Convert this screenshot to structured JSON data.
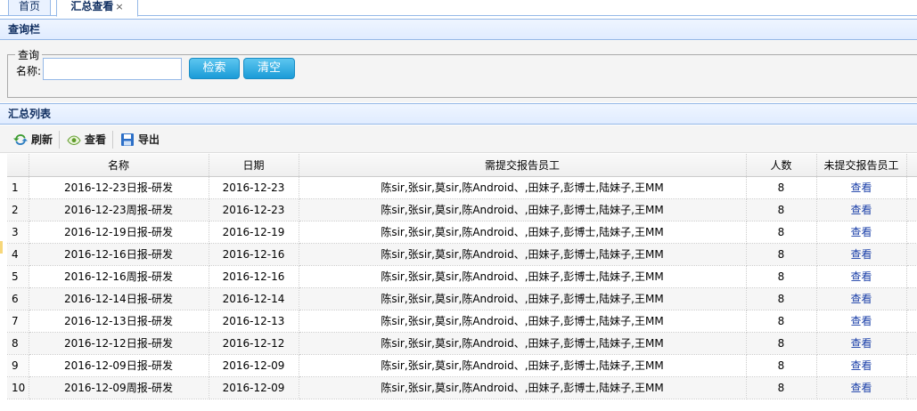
{
  "tabs": [
    {
      "label": "首页",
      "active": false
    },
    {
      "label": "汇总查看",
      "active": true,
      "close": "×"
    }
  ],
  "query_panel": {
    "title": "查询栏",
    "legend": "查询",
    "name_label": "名称:",
    "name_value": "",
    "search_button": "检索",
    "clear_button": "清空"
  },
  "list_panel": {
    "title": "汇总列表",
    "toolbar": {
      "refresh": "刷新",
      "view": "查看",
      "export": "导出"
    },
    "columns": [
      "",
      "名称",
      "日期",
      "需提交报告员工",
      "人数",
      "未提交报告员工"
    ],
    "rows": [
      {
        "no": "1",
        "name": "2016-12-23日报-研发",
        "date": "2016-12-23",
        "staff": "陈sir,张sir,莫sir,陈Android、,田妹子,彭博士,陆妹子,王MM",
        "count": "8",
        "action": "查看"
      },
      {
        "no": "2",
        "name": "2016-12-23周报-研发",
        "date": "2016-12-23",
        "staff": "陈sir,张sir,莫sir,陈Android、,田妹子,彭博士,陆妹子,王MM",
        "count": "8",
        "action": "查看"
      },
      {
        "no": "3",
        "name": "2016-12-19日报-研发",
        "date": "2016-12-19",
        "staff": "陈sir,张sir,莫sir,陈Android、,田妹子,彭博士,陆妹子,王MM",
        "count": "8",
        "action": "查看"
      },
      {
        "no": "4",
        "name": "2016-12-16日报-研发",
        "date": "2016-12-16",
        "staff": "陈sir,张sir,莫sir,陈Android、,田妹子,彭博士,陆妹子,王MM",
        "count": "8",
        "action": "查看"
      },
      {
        "no": "5",
        "name": "2016-12-16周报-研发",
        "date": "2016-12-16",
        "staff": "陈sir,张sir,莫sir,陈Android、,田妹子,彭博士,陆妹子,王MM",
        "count": "8",
        "action": "查看"
      },
      {
        "no": "6",
        "name": "2016-12-14日报-研发",
        "date": "2016-12-14",
        "staff": "陈sir,张sir,莫sir,陈Android、,田妹子,彭博士,陆妹子,王MM",
        "count": "8",
        "action": "查看"
      },
      {
        "no": "7",
        "name": "2016-12-13日报-研发",
        "date": "2016-12-13",
        "staff": "陈sir,张sir,莫sir,陈Android、,田妹子,彭博士,陆妹子,王MM",
        "count": "8",
        "action": "查看"
      },
      {
        "no": "8",
        "name": "2016-12-12日报-研发",
        "date": "2016-12-12",
        "staff": "陈sir,张sir,莫sir,陈Android、,田妹子,彭博士,陆妹子,王MM",
        "count": "8",
        "action": "查看"
      },
      {
        "no": "9",
        "name": "2016-12-09日报-研发",
        "date": "2016-12-09",
        "staff": "陈sir,张sir,莫sir,陈Android、,田妹子,彭博士,陆妹子,王MM",
        "count": "8",
        "action": "查看"
      },
      {
        "no": "10",
        "name": "2016-12-09周报-研发",
        "date": "2016-12-09",
        "staff": "陈sir,张sir,莫sir,陈Android、,田妹子,彭博士,陆妹子,王MM",
        "count": "8",
        "action": "查看"
      }
    ]
  },
  "icons": {
    "refresh": "refresh-icon",
    "view": "eye-icon",
    "export": "save-icon"
  },
  "colors": {
    "header_border": "#95b8e7",
    "button": "#1b9bd7",
    "link": "#1a3fa8"
  }
}
